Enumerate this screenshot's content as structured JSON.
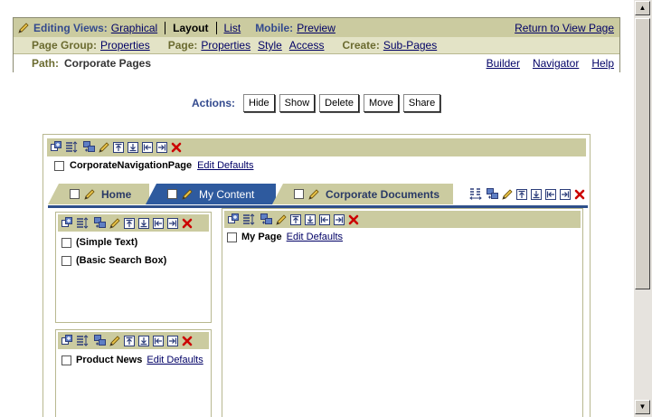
{
  "header": {
    "editing_views_label": "Editing Views:",
    "graphical": "Graphical",
    "layout": "Layout",
    "list": "List",
    "mobile_label": "Mobile:",
    "preview": "Preview",
    "return_link": "Return to View Page",
    "page_group_label": "Page Group:",
    "page_group_properties": "Properties",
    "page_label": "Page:",
    "page_properties": "Properties",
    "style": "Style",
    "access": "Access",
    "create_label": "Create:",
    "sub_pages": "Sub-Pages",
    "path_label": "Path:",
    "path_value": "Corporate Pages",
    "builder": "Builder",
    "navigator": "Navigator",
    "help": "Help"
  },
  "actions": {
    "label": "Actions:",
    "buttons": [
      "Hide",
      "Show",
      "Delete",
      "Move",
      "Share"
    ]
  },
  "top_region": {
    "portlet_name": "CorporateNavigationPage",
    "edit_defaults": "Edit Defaults"
  },
  "tabs": [
    {
      "label": "Home",
      "active": false
    },
    {
      "label": "My Content",
      "active": true
    },
    {
      "label": "Corporate Documents",
      "active": false
    }
  ],
  "left_region_top": {
    "items": [
      "(Simple Text)",
      "(Basic Search Box)"
    ]
  },
  "left_region_bottom": {
    "portlet_name": "Product News",
    "edit_defaults": "Edit Defaults"
  },
  "right_region": {
    "portlet_name": "My Page",
    "edit_defaults": "Edit Defaults"
  },
  "colors": {
    "tab_active": "#2e5a9e",
    "tab_inactive": "#cbcba0",
    "toolbar": "#cbcba0",
    "label_olive": "#6b6b30",
    "label_blue": "#334a8e"
  }
}
